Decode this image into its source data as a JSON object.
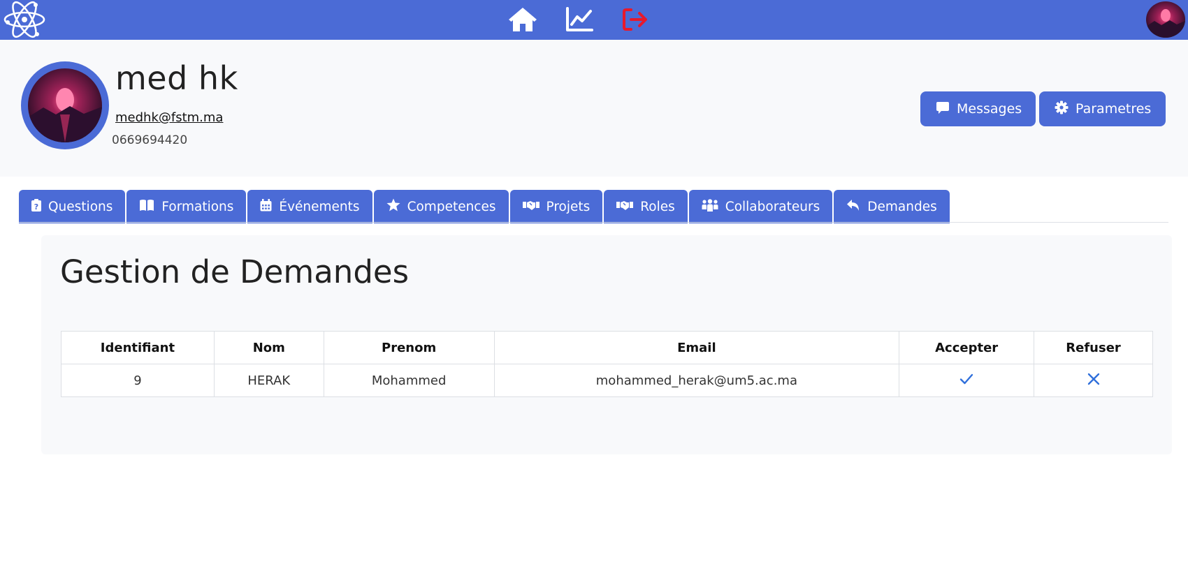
{
  "nav": {
    "icons": [
      "atom-logo-icon",
      "home-icon",
      "chart-line-icon",
      "logout-icon",
      "user-avatar"
    ],
    "colors": {
      "bar": "#4b6bd6",
      "logout": "#e8192c"
    }
  },
  "profile": {
    "name": "med hk",
    "email": "medhk@fstm.ma",
    "phone": "0669694420",
    "buttons": {
      "messages": "Messages",
      "settings": "Parametres"
    }
  },
  "tabs": [
    {
      "label": "Questions",
      "icon": "clipboard-question-icon"
    },
    {
      "label": "Formations",
      "icon": "book-open-icon"
    },
    {
      "label": "Événements",
      "icon": "calendar-icon"
    },
    {
      "label": "Competences",
      "icon": "star-icon"
    },
    {
      "label": "Projets",
      "icon": "handshake-icon"
    },
    {
      "label": "Roles",
      "icon": "handshake-icon"
    },
    {
      "label": "Collaborateurs",
      "icon": "people-group-icon"
    },
    {
      "label": "Demandes",
      "icon": "reply-icon"
    }
  ],
  "main": {
    "title": "Gestion de Demandes",
    "table": {
      "headers": [
        "Identifiant",
        "Nom",
        "Prenom",
        "Email",
        "Accepter",
        "Refuser"
      ],
      "rows": [
        {
          "id": "9",
          "nom": "HERAK",
          "prenom": "Mohammed",
          "email": "mohammed_herak@um5.ac.ma",
          "accept_icon": "check-icon",
          "refuse_icon": "x-icon"
        }
      ]
    }
  }
}
